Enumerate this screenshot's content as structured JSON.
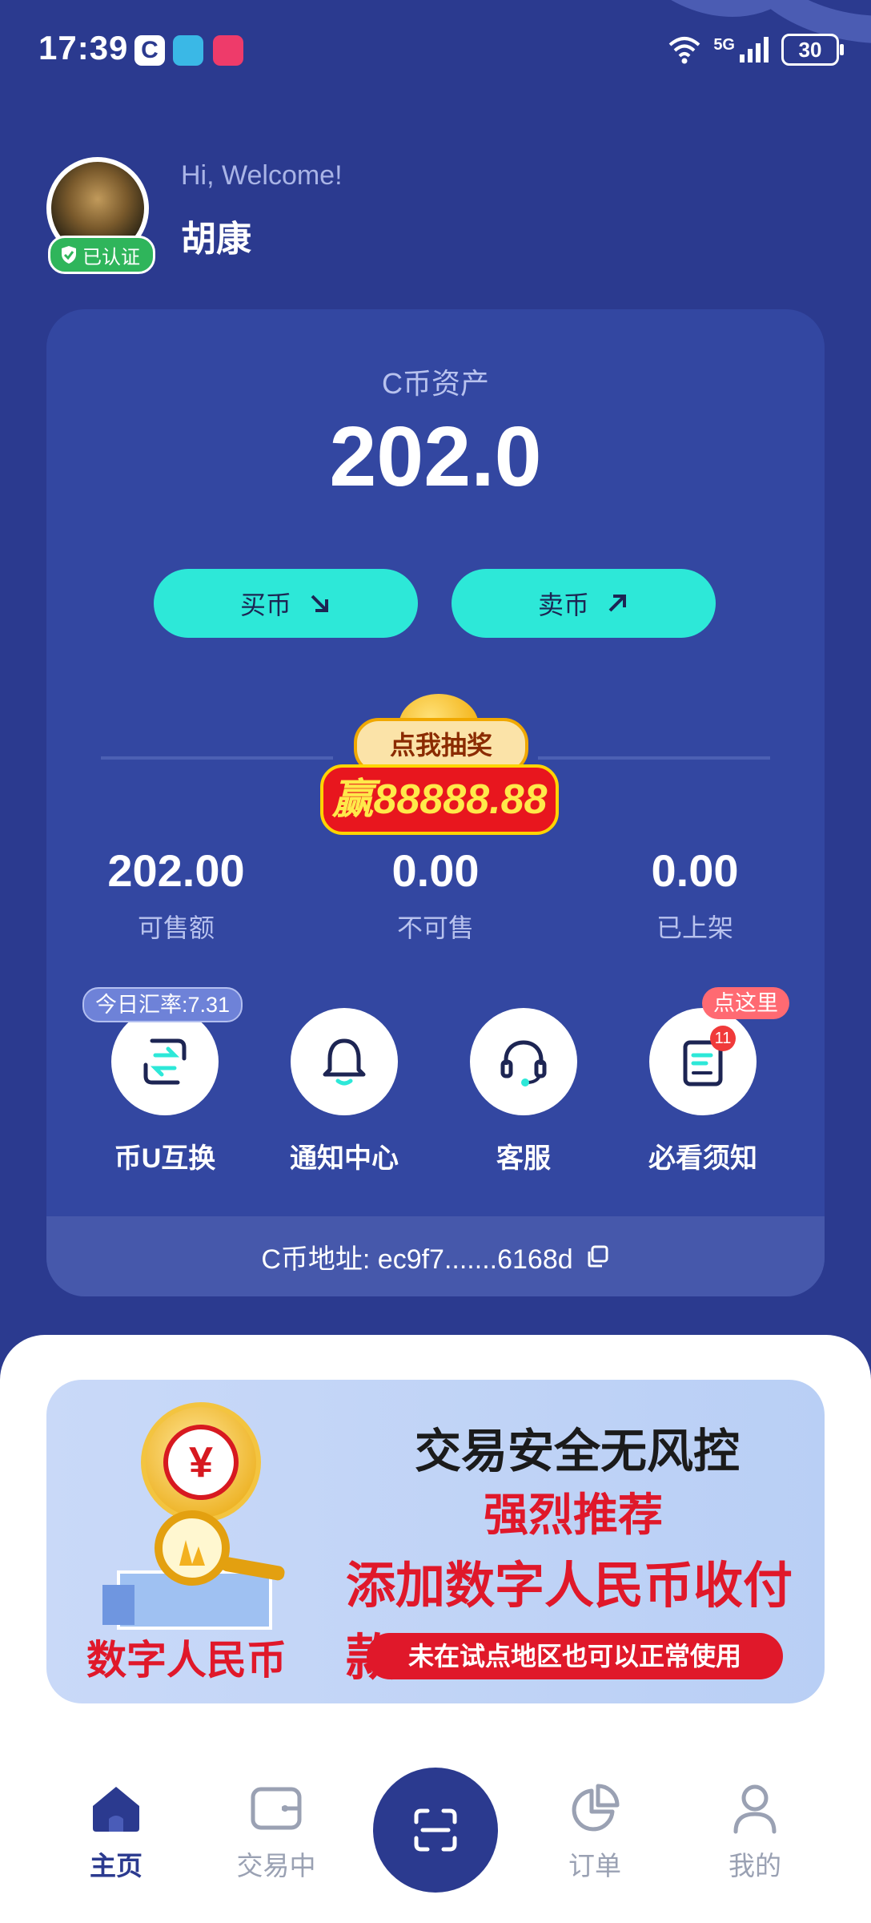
{
  "status_bar": {
    "time": "17:39",
    "network": "5G",
    "battery": "30",
    "app_icons": [
      "c-app-icon",
      "book-app-icon",
      "video-app-icon"
    ]
  },
  "profile": {
    "verified_label": "已认证",
    "greeting": "Hi, Welcome!",
    "name": "胡康"
  },
  "asset": {
    "label": "C币资产",
    "value": "202.0",
    "buy_label": "买币",
    "sell_label": "卖币"
  },
  "lottery": {
    "top_text": "点我抽奖",
    "bottom_text": "赢88888.88"
  },
  "stats": [
    {
      "value": "202.00",
      "label": "可售额"
    },
    {
      "value": "0.00",
      "label": "不可售"
    },
    {
      "value": "0.00",
      "label": "已上架"
    }
  ],
  "actions": [
    {
      "label": "币U互换",
      "tag": "今日汇率:7.31",
      "icon": "exchange-icon"
    },
    {
      "label": "通知中心",
      "icon": "bell-icon"
    },
    {
      "label": "客服",
      "icon": "headset-icon"
    },
    {
      "label": "必看须知",
      "tag": "点这里",
      "badge": "11",
      "icon": "notice-icon"
    }
  ],
  "address": {
    "label": "C币地址: ec9f7.......6168d",
    "icon": "copy-icon"
  },
  "banner": {
    "line1": "交易安全无风控",
    "line2": "强烈推荐",
    "line3": "添加数字人民币收付款",
    "line4": "未在试点地区也可以正常使用",
    "logo_label": "数字人民币"
  },
  "nav": [
    {
      "label": "主页",
      "icon": "home-icon",
      "active": true
    },
    {
      "label": "交易中",
      "icon": "wallet-icon",
      "active": false
    },
    {
      "label": "",
      "icon": "scan-icon",
      "active": false
    },
    {
      "label": "订单",
      "icon": "pie-chart-icon",
      "active": false
    },
    {
      "label": "我的",
      "icon": "profile-icon",
      "active": false
    }
  ],
  "colors": {
    "background": "#2b3a8f",
    "card": "#3347a1",
    "accent": "#2de8d8",
    "verified": "#2fb55b",
    "alert": "#f03a3a"
  }
}
